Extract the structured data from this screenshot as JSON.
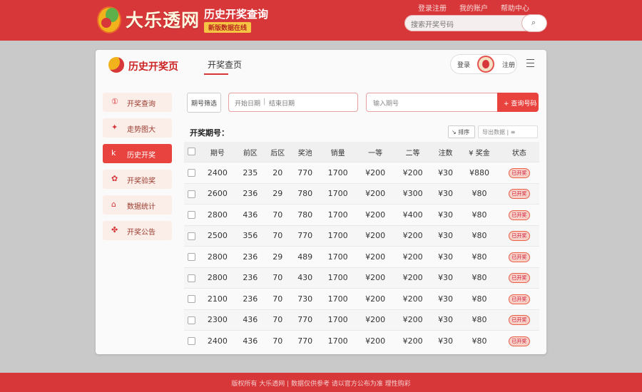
{
  "header": {
    "brand_name": "大乐透网",
    "brand_tagline": "历史开奖查询",
    "brand_sub": "新版数据在线",
    "links": [
      "登录注册",
      "我的账户",
      "帮助中心"
    ],
    "search_placeholder": "搜索开奖号码",
    "search_icon": "magnifier"
  },
  "card": {
    "title": "历史开奖页",
    "tab": "开奖查页",
    "user_left": "登录",
    "user_right": "注册"
  },
  "sidebar": {
    "items": [
      {
        "icon": "①",
        "label": "开奖查询",
        "active": false
      },
      {
        "icon": "✦",
        "label": "走势图大",
        "active": false
      },
      {
        "icon": "k",
        "label": "历史开奖",
        "active": true
      },
      {
        "icon": "✿",
        "label": "开奖验奖",
        "active": false
      },
      {
        "icon": "⌂",
        "label": "数据统计",
        "active": false
      },
      {
        "icon": "✤",
        "label": "开奖公告",
        "active": false
      }
    ]
  },
  "filters": {
    "period_select": "期号筛选",
    "date_from": "开始日期",
    "date_to": "结束日期",
    "issue_placeholder": "输入期号",
    "query_button": "+ 查询号码"
  },
  "table": {
    "section_title": "开奖期号：",
    "tool_sort": "↘ 排序",
    "tool_export": "导出数据 | ≡",
    "columns": [
      "",
      "期号",
      "前区",
      "后区",
      "奖池",
      "销量",
      "一等",
      "二等",
      "注数",
      "¥ 奖金",
      "状态"
    ],
    "rows": [
      [
        "2400",
        "235",
        "20",
        "770",
        "1700",
        "¥200",
        "¥200",
        "¥30",
        "¥880",
        "已开奖"
      ],
      [
        "2600",
        "236",
        "29",
        "780",
        "1700",
        "¥200",
        "¥300",
        "¥30",
        "¥80",
        "已开奖"
      ],
      [
        "2800",
        "436",
        "70",
        "780",
        "1700",
        "¥200",
        "¥400",
        "¥30",
        "¥80",
        "已开奖"
      ],
      [
        "2500",
        "356",
        "70",
        "770",
        "1700",
        "¥200",
        "¥200",
        "¥30",
        "¥80",
        "已开奖"
      ],
      [
        "2800",
        "236",
        "29",
        "489",
        "1700",
        "¥200",
        "¥200",
        "¥30",
        "¥80",
        "已开奖"
      ],
      [
        "2800",
        "236",
        "70",
        "430",
        "1700",
        "¥200",
        "¥200",
        "¥30",
        "¥80",
        "已开奖"
      ],
      [
        "2100",
        "236",
        "70",
        "730",
        "1700",
        "¥200",
        "¥200",
        "¥30",
        "¥80",
        "已开奖"
      ],
      [
        "2300",
        "436",
        "70",
        "770",
        "1700",
        "¥200",
        "¥200",
        "¥30",
        "¥80",
        "已开奖"
      ],
      [
        "2400",
        "436",
        "70",
        "770",
        "1700",
        "¥200",
        "¥200",
        "¥30",
        "¥80",
        "已开奖"
      ]
    ]
  },
  "footer": {
    "text": "版权所有 大乐透网 | 数据仅供参考 请以官方公布为准 理性购彩"
  },
  "colors": {
    "brand_red": "#d8373a",
    "accent_gold": "#e8a21a",
    "prize_red": "#e03535"
  }
}
